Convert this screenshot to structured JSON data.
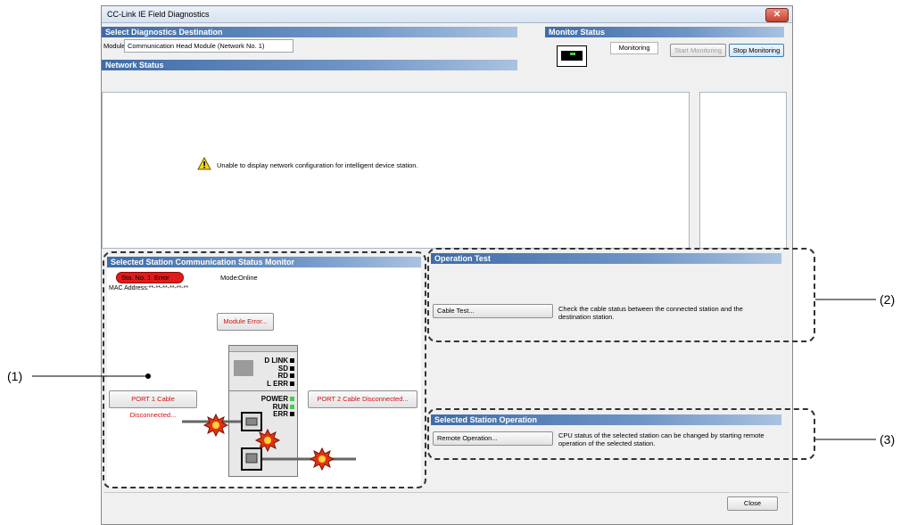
{
  "window": {
    "title": "CC-Link IE Field Diagnostics",
    "close_glyph": "✕"
  },
  "select_dest": {
    "header": "Select Diagnostics Destination",
    "module_label": "Module",
    "module_value": "Communication Head Module (Network No. 1)"
  },
  "monitor": {
    "header": "Monitor Status",
    "status": "Monitoring",
    "start_label": "Start Monitoring",
    "stop_label": "Stop Monitoring"
  },
  "network": {
    "header": "Network Status",
    "message": "Unable to display network configuration for intelligent device station."
  },
  "station_monitor": {
    "header": "Selected Station Communication Status Monitor",
    "badge_sta": "Sta. No. 1",
    "badge_status": "Error",
    "mode_label": "Mode:",
    "mode_value": "Online",
    "mac": "MAC Address:**-**-**-**-**-**",
    "module_error_label": "Module Error...",
    "port1_label": "PORT 1 Cable Disconnected...",
    "port2_label": "PORT 2 Cable Disconnected...",
    "leds_top": [
      "D LINK",
      "SD",
      "RD",
      "L ERR"
    ],
    "leds_bottom": [
      "POWER",
      "RUN",
      "ERR"
    ]
  },
  "operation_test": {
    "header": "Operation Test",
    "cable_test_label": "Cable Test...",
    "cable_test_desc": "Check the cable status between the connected station and the destination station."
  },
  "station_operation": {
    "header": "Selected Station Operation",
    "remote_label": "Remote Operation...",
    "remote_desc": "CPU status of the selected station can be changed by starting remote operation of the selected station."
  },
  "footer": {
    "close_label": "Close"
  },
  "callouts": {
    "c1": "(1)",
    "c2": "(2)",
    "c3": "(3)"
  },
  "colors": {
    "header_blue": "#3f6ca7",
    "error_red": "#e11b1b",
    "led_green": "#4cc84a"
  }
}
